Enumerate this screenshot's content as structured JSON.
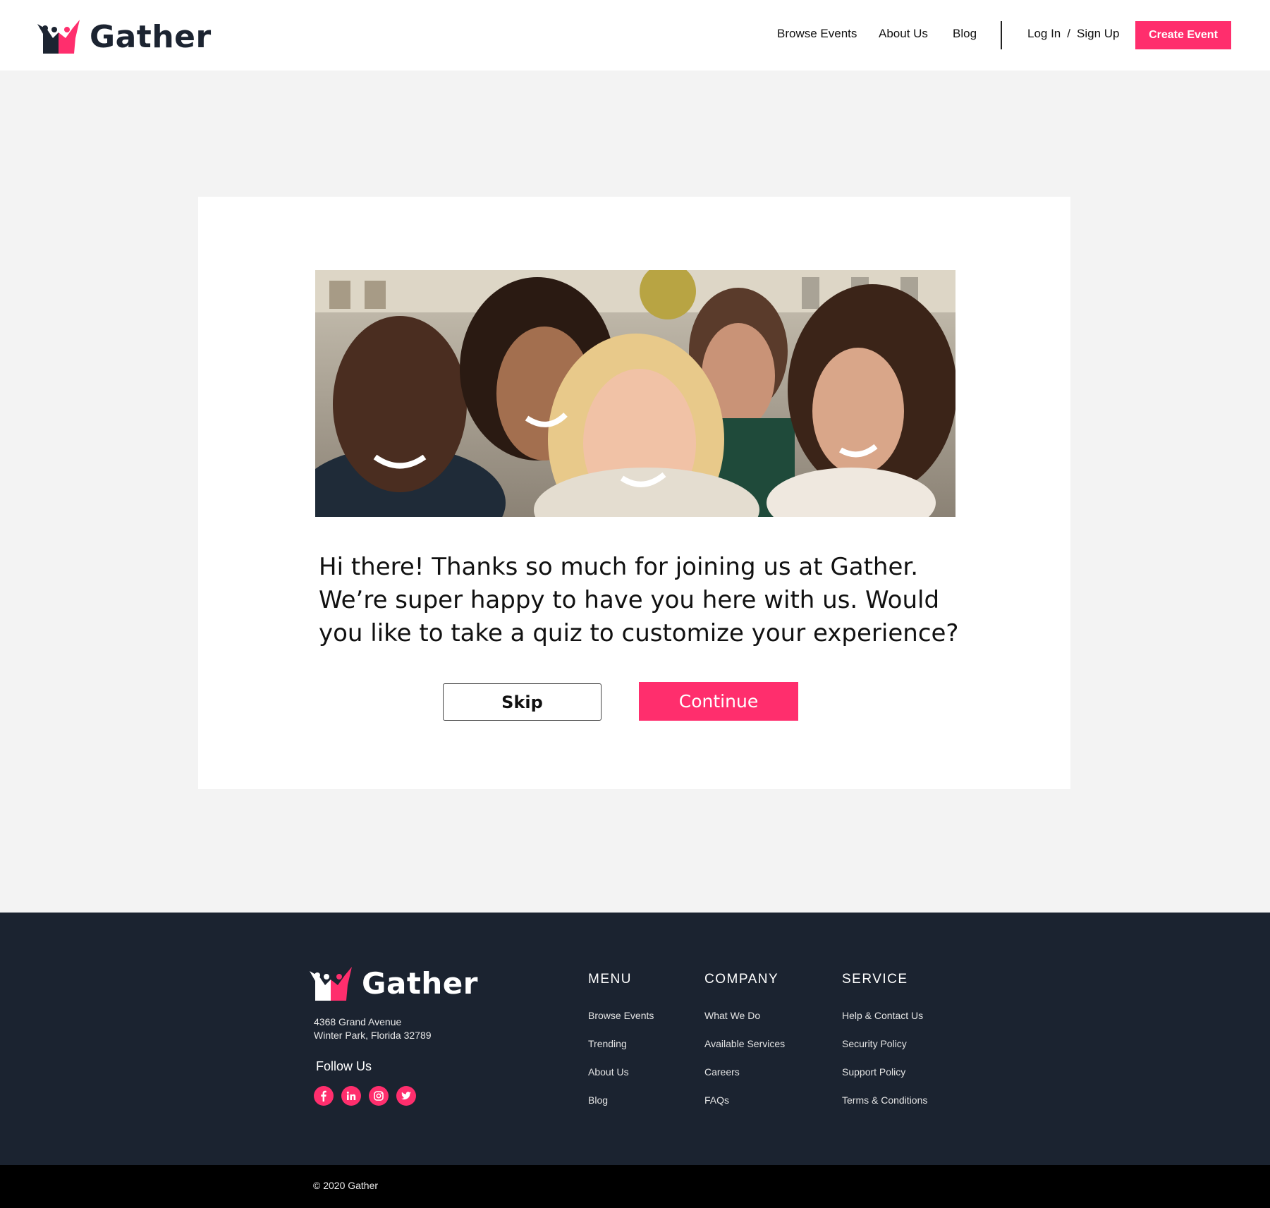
{
  "brand": {
    "name": "Gather",
    "accent_color": "#ff2e6d",
    "dark_color": "#1c2431"
  },
  "header": {
    "nav": [
      "Browse Events",
      "About Us",
      "Blog"
    ],
    "login_label": "Log In",
    "separator": "/",
    "signup_label": "Sign Up",
    "create_event_label": "Create Event"
  },
  "welcome": {
    "image_icon": "group-selfie-photo",
    "message": "Hi there! Thanks so much for joining us at Gather. We’re super happy to have you here with us. Would you like to take a quiz to customize your experience?",
    "skip_label": "Skip",
    "continue_label": "Continue"
  },
  "footer": {
    "address_line1": "4368 Grand Avenue",
    "address_line2": "Winter Park, Florida 32789",
    "follow_label": "Follow Us",
    "socials": [
      "facebook-icon",
      "linkedin-icon",
      "instagram-icon",
      "twitter-icon"
    ],
    "menu_title": "MENU",
    "menu_links": [
      "Browse Events",
      "Trending",
      "About Us",
      "Blog"
    ],
    "company_title": "COMPANY",
    "company_links": [
      "What We Do",
      "Available Services",
      "Careers",
      "FAQs"
    ],
    "service_title": "SERVICE",
    "service_links": [
      "Help & Contact Us",
      "Security Policy",
      "Support Policy",
      "Terms & Conditions"
    ],
    "copyright": "© 2020 Gather"
  }
}
